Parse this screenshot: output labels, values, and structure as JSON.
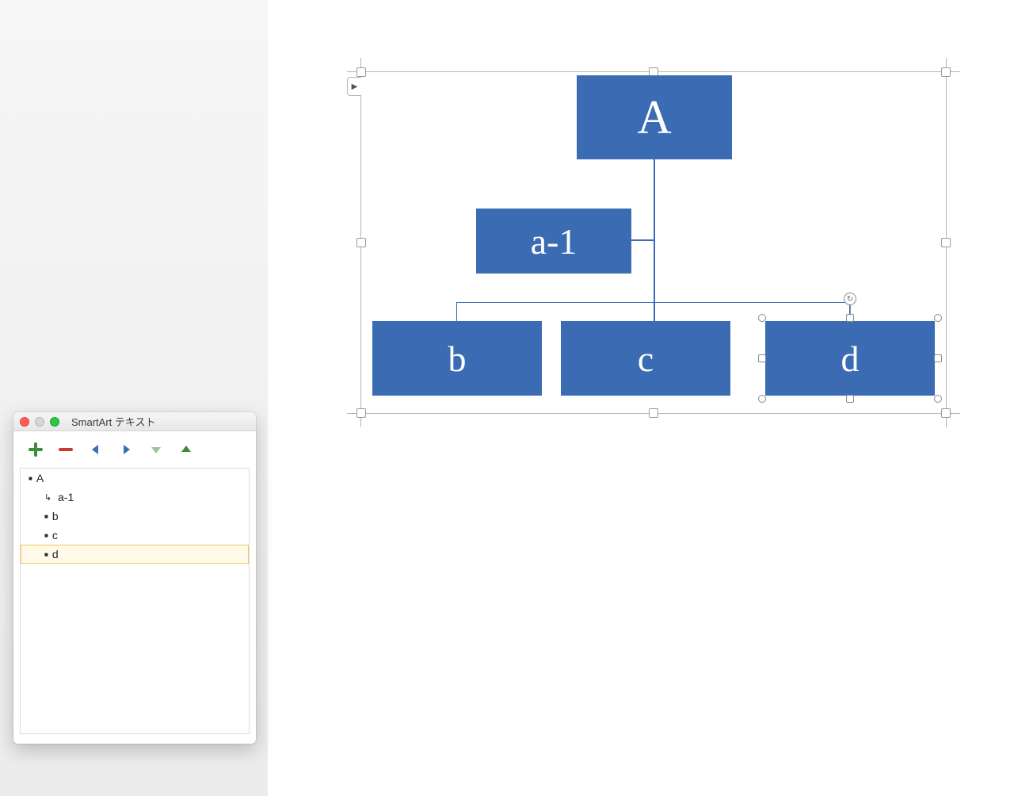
{
  "textpane": {
    "title": "SmartArt テキスト",
    "tools": {
      "add": "add",
      "remove": "remove",
      "outdent": "outdent",
      "indent": "indent",
      "move_down": "move-down",
      "move_up": "move-up"
    },
    "items": [
      {
        "text": "A",
        "level": 0,
        "assistant": false,
        "selected": false
      },
      {
        "text": "a-1",
        "level": 1,
        "assistant": true,
        "selected": false
      },
      {
        "text": "b",
        "level": 1,
        "assistant": false,
        "selected": false
      },
      {
        "text": "c",
        "level": 1,
        "assistant": false,
        "selected": false
      },
      {
        "text": "d",
        "level": 1,
        "assistant": false,
        "selected": true
      }
    ]
  },
  "smartart": {
    "toggle_glyph": "▶",
    "nodes": {
      "root": "A",
      "assistant": "a-1",
      "children": [
        "b",
        "c",
        "d"
      ],
      "selected_child": "d"
    },
    "colors": {
      "node_fill": "#3b6cb3",
      "node_text": "#ffffff"
    }
  }
}
